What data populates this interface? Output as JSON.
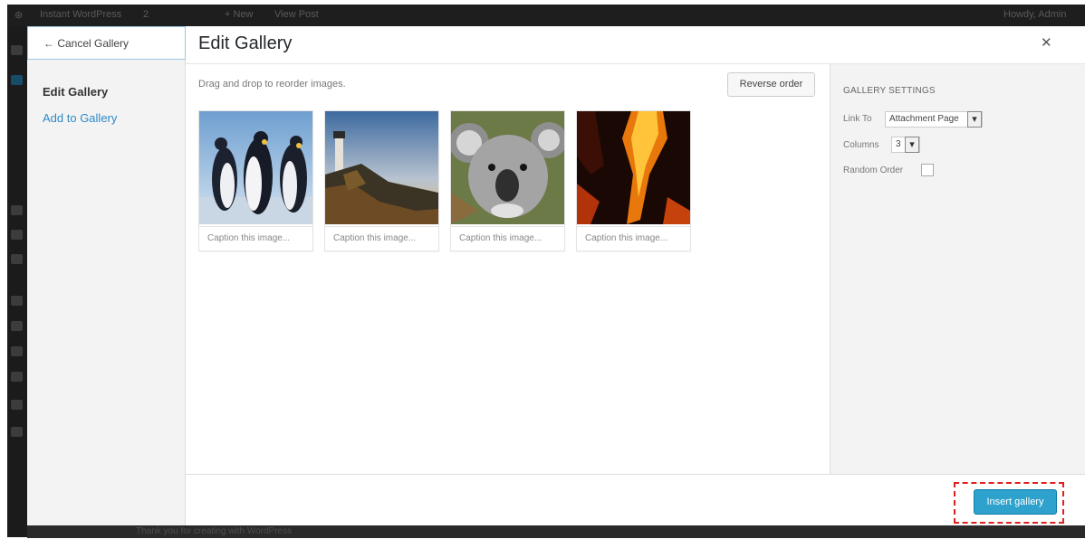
{
  "admin_bar": {
    "site_name": "Instant WordPress",
    "comments": "2",
    "new_label": "+ New",
    "view_label": "View Post",
    "greeting": "Howdy, Admin"
  },
  "footer": {
    "text": "Thank you for creating with WordPress"
  },
  "modal": {
    "title": "Edit Gallery",
    "close_icon": "close-icon",
    "cancel_label": "← Cancel Gallery",
    "menu": [
      {
        "label": "Edit Gallery",
        "active": true
      },
      {
        "label": "Add to Gallery",
        "active": false
      }
    ],
    "drag_hint": "Drag and drop to reorder images.",
    "reverse_label": "Reverse order",
    "images": [
      {
        "subject": "penguins",
        "caption_placeholder": "Caption this image..."
      },
      {
        "subject": "lighthouse",
        "caption_placeholder": "Caption this image..."
      },
      {
        "subject": "koala",
        "caption_placeholder": "Caption this image..."
      },
      {
        "subject": "fire",
        "caption_placeholder": "Caption this image..."
      }
    ]
  },
  "settings": {
    "heading": "GALLERY SETTINGS",
    "link_to_label": "Link To",
    "link_to_value": "Attachment Page",
    "columns_label": "Columns",
    "columns_value": "3",
    "random_label": "Random Order",
    "random_checked": false
  },
  "toolbar": {
    "insert_label": "Insert gallery"
  },
  "colors": {
    "primary_button": "#2ea2cc",
    "link": "#2e8ac7",
    "highlight": "#e01f1f"
  }
}
